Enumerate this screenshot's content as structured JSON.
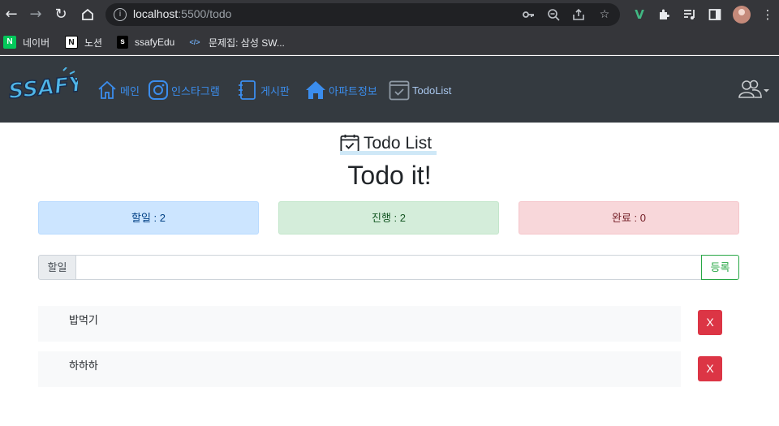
{
  "browser": {
    "url_host": "localhost",
    "url_rest": ":5500/todo",
    "bookmarks": [
      {
        "label": "네이버",
        "icon": "naver-icon",
        "icon_char": "N",
        "color": "#03c75a"
      },
      {
        "label": "노션",
        "icon": "notion-icon",
        "icon_char": "N",
        "color": "#ffffff"
      },
      {
        "label": "ssafyEdu",
        "icon": "ssafy-icon",
        "icon_char": "s",
        "color": "#000000"
      },
      {
        "label": "문제집: 삼성 SW...",
        "icon": "code-icon",
        "icon_char": "</>",
        "color": "#35363a"
      }
    ]
  },
  "navbar": {
    "logo_text": "SSAFY",
    "items": [
      {
        "label": "메인",
        "icon": "home-icon"
      },
      {
        "label": "인스타그램",
        "icon": "instagram-icon"
      },
      {
        "label": "게시판",
        "icon": "journal-icon"
      },
      {
        "label": "아파트정보",
        "icon": "house-fill-icon"
      },
      {
        "label": "TodoList",
        "icon": "calendar-check-icon"
      }
    ]
  },
  "main": {
    "heading": "Todo List",
    "title": "Todo it!",
    "stats": {
      "todo": "할일 : 2",
      "progress": "진행 : 2",
      "done": "완료 : 0"
    },
    "input": {
      "label": "할일",
      "value": "",
      "placeholder": "",
      "submit_label": "등록"
    },
    "todos": [
      {
        "text": "밥먹기",
        "delete_label": "X"
      },
      {
        "text": "하하하",
        "delete_label": "X"
      }
    ]
  },
  "colors": {
    "navbar_bg": "#343a40",
    "link": "#3b8ded",
    "success": "#28a745",
    "danger": "#dc3545"
  }
}
